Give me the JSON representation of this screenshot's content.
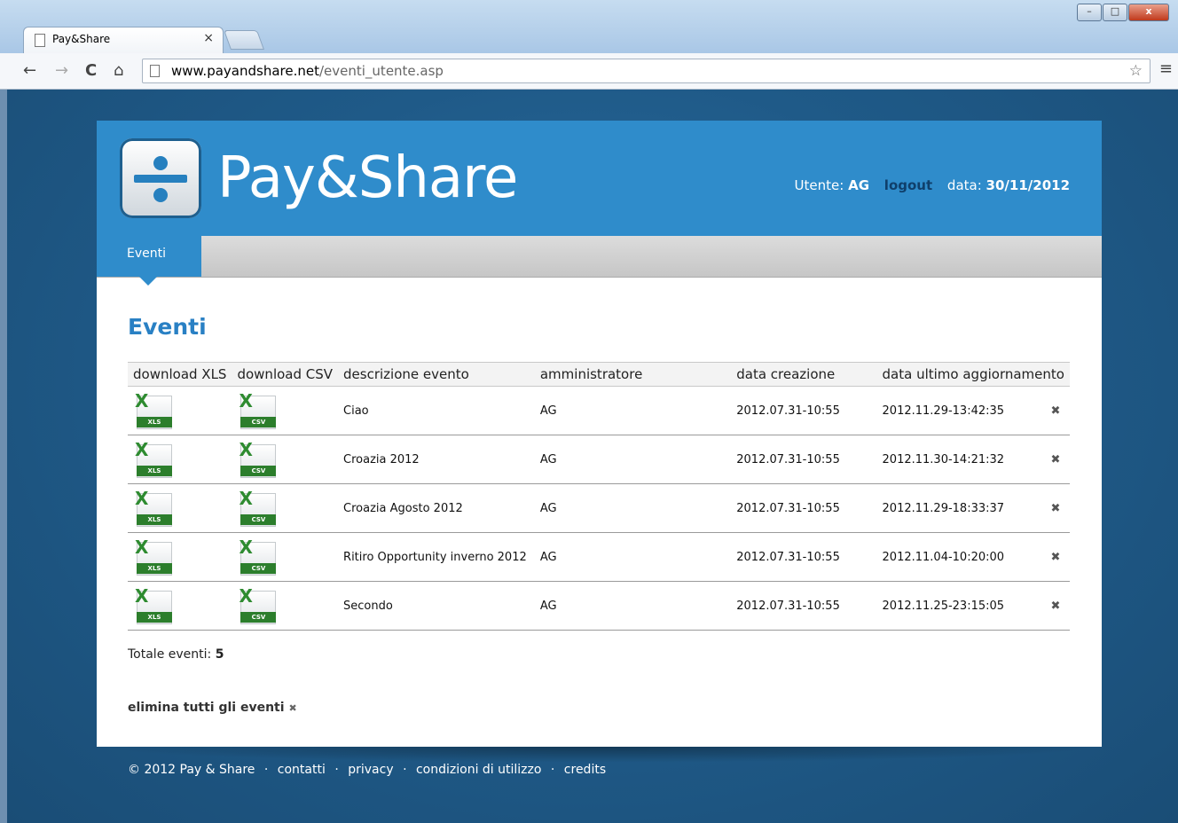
{
  "browser": {
    "tab_title": "Pay&Share",
    "tab_close": "×",
    "url_domain": "www.payandshare.net",
    "url_path": "/eventi_utente.asp"
  },
  "site": {
    "brand": "Pay&Share",
    "user_label": "Utente:",
    "user_value": "AG",
    "logout": "logout",
    "date_label": "data:",
    "date_value": "30/11/2012",
    "nav_tab": "Eventi"
  },
  "main": {
    "heading": "Eventi",
    "columns": [
      "download XLS",
      "download CSV",
      "descrizione evento",
      "amministratore",
      "data creazione",
      "data ultimo aggiornamento"
    ],
    "icon_labels": {
      "xls": "XLS",
      "csv": "CSV",
      "x": "X"
    },
    "delete_symbol": "✖",
    "rows": [
      {
        "descrizione": "Ciao",
        "amministratore": "AG",
        "creazione": "2012.07.31-10:55",
        "aggiornamento": "2012.11.29-13:42:35"
      },
      {
        "descrizione": "Croazia 2012",
        "amministratore": "AG",
        "creazione": "2012.07.31-10:55",
        "aggiornamento": "2012.11.30-14:21:32"
      },
      {
        "descrizione": "Croazia Agosto 2012",
        "amministratore": "AG",
        "creazione": "2012.07.31-10:55",
        "aggiornamento": "2012.11.29-18:33:37"
      },
      {
        "descrizione": "Ritiro Opportunity inverno 2012",
        "amministratore": "AG",
        "creazione": "2012.07.31-10:55",
        "aggiornamento": "2012.11.04-10:20:00"
      },
      {
        "descrizione": "Secondo",
        "amministratore": "AG",
        "creazione": "2012.07.31-10:55",
        "aggiornamento": "2012.11.25-23:15:05"
      }
    ],
    "totale_label": "Totale eventi:",
    "totale_value": "5",
    "elimina": "elimina tutti gli eventi",
    "elimina_symbol": "✖"
  },
  "footer": {
    "copyright": "© 2012 Pay & Share",
    "links": [
      "contatti",
      "privacy",
      "condizioni di utilizzo",
      "credits"
    ],
    "separator": "·"
  },
  "colors": {
    "header_blue": "#2f8ccb",
    "heading_blue": "#2980c4",
    "excel_green": "#2c7e2c"
  }
}
